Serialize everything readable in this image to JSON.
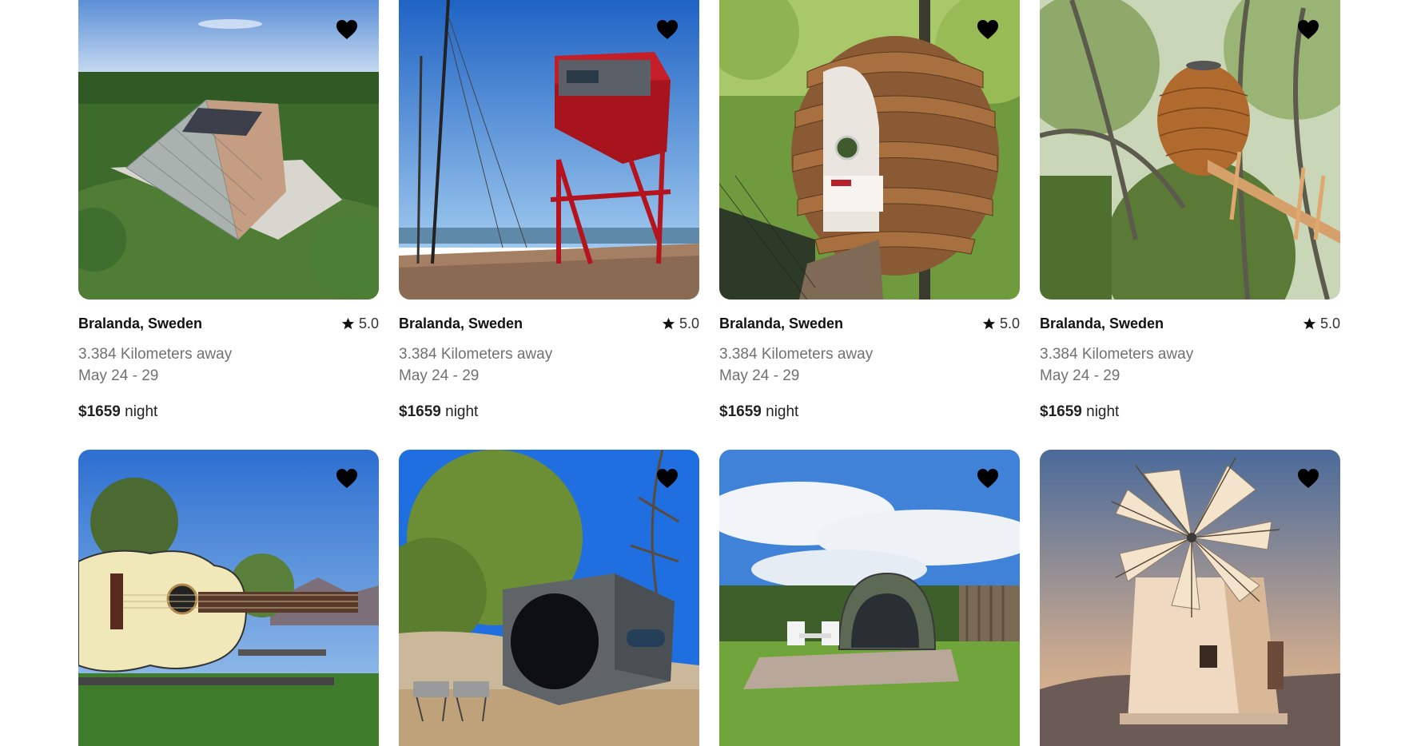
{
  "listings": [
    {
      "location": "Bralanda, Sweden",
      "rating": "5.0",
      "distance": "3.384 Kilometers away",
      "dates": "May 24 - 29",
      "price": "$1659",
      "price_unit": "night",
      "image": "glass-a-frame-house-in-forest",
      "favorited": true
    },
    {
      "location": "Bralanda, Sweden",
      "rating": "5.0",
      "distance": "3.384 Kilometers away",
      "dates": "May 24 - 29",
      "price": "$1659",
      "price_unit": "night",
      "image": "red-crane-cabin-at-harbor",
      "favorited": true
    },
    {
      "location": "Bralanda, Sweden",
      "rating": "5.0",
      "distance": "3.384 Kilometers away",
      "dates": "May 24 - 29",
      "price": "$1659",
      "price_unit": "night",
      "image": "wooden-pod-treehouse",
      "favorited": true
    },
    {
      "location": "Bralanda, Sweden",
      "rating": "5.0",
      "distance": "3.384 Kilometers away",
      "dates": "May 24 - 29",
      "price": "$1659",
      "price_unit": "night",
      "image": "pinecone-treehouse-with-bridge",
      "favorited": true
    }
  ],
  "listings_row2": [
    {
      "image": "guitar-shaped-house",
      "favorited": true
    },
    {
      "image": "grey-cube-cabin",
      "favorited": true
    },
    {
      "image": "dome-pod-cabin-with-patio",
      "favorited": true
    },
    {
      "image": "stone-windmill-at-sunset",
      "favorited": true
    }
  ],
  "icons": {
    "favorite": "heart-icon",
    "rating": "star-icon"
  },
  "colors": {
    "heart": "#000000",
    "text": "#222222",
    "muted": "#717171"
  }
}
